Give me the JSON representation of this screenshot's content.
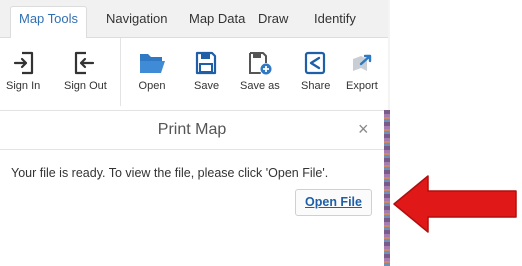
{
  "tabs": [
    {
      "label": "Map Tools",
      "active": true
    },
    {
      "label": "Navigation",
      "active": false
    },
    {
      "label": "Map Data",
      "active": false
    },
    {
      "label": "Draw",
      "active": false
    },
    {
      "label": "Identify",
      "active": false
    }
  ],
  "toolbar": {
    "sign_in": "Sign In",
    "sign_out": "Sign Out",
    "open": "Open",
    "save": "Save",
    "save_as": "Save as",
    "share": "Share",
    "export": "Export"
  },
  "panel": {
    "title": "Print Map",
    "close": "×",
    "message": "Your file is ready. To view the file, please click 'Open File'.",
    "open_file": "Open File"
  },
  "colors": {
    "active_tab_text": "#3370b3",
    "folder_blue": "#2f78c4",
    "arrow_red": "#e01818"
  }
}
